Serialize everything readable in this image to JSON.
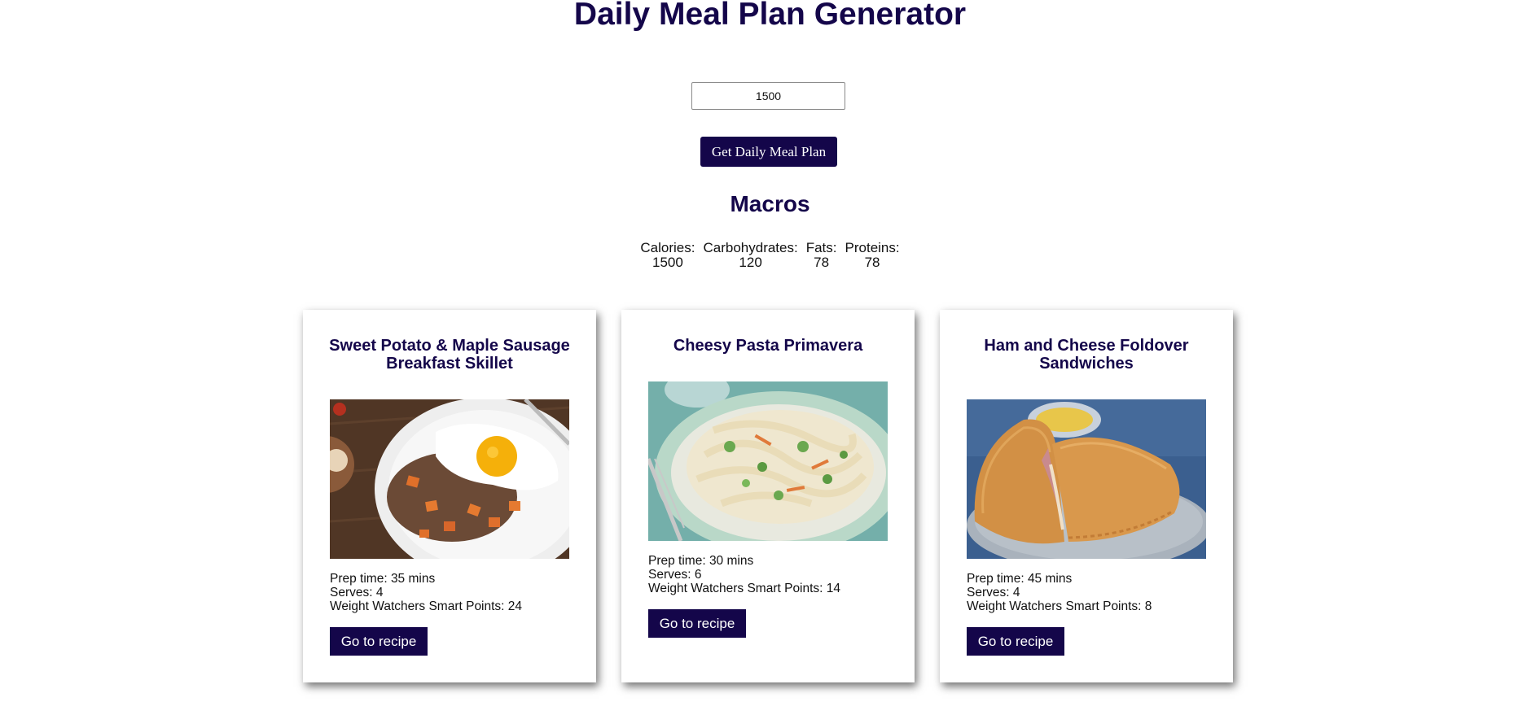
{
  "app": {
    "title": "Daily Meal Plan Generator"
  },
  "calorie_input": {
    "value": "1500"
  },
  "generate_button": {
    "label": "Get Daily Meal Plan"
  },
  "macros": {
    "heading": "Macros",
    "items": [
      {
        "label": "Calories:",
        "value": "1500"
      },
      {
        "label": "Carbohydrates:",
        "value": "120"
      },
      {
        "label": "Fats:",
        "value": "78"
      },
      {
        "label": "Proteins:",
        "value": "78"
      }
    ]
  },
  "meals": [
    {
      "title": "Sweet Potato & Maple Sausage Breakfast Skillet",
      "image": "skillet-with-fried-egg-photo",
      "prep": "Prep time: 35 mins",
      "serves": "Serves: 4",
      "points": "Weight Watchers Smart Points: 24",
      "button": "Go to recipe"
    },
    {
      "title": "Cheesy Pasta Primavera",
      "image": "pasta-primavera-photo",
      "prep": "Prep time: 30 mins",
      "serves": "Serves: 6",
      "points": "Weight Watchers Smart Points: 14",
      "button": "Go to recipe"
    },
    {
      "title": "Ham and Cheese Foldover Sandwiches",
      "image": "foldover-sandwich-photo",
      "prep": "Prep time: 45 mins",
      "serves": "Serves: 4",
      "points": "Weight Watchers Smart Points: 8",
      "button": "Go to recipe"
    }
  ],
  "colors": {
    "accent": "#14064a",
    "background": "#ffffff",
    "text": "#111111"
  }
}
